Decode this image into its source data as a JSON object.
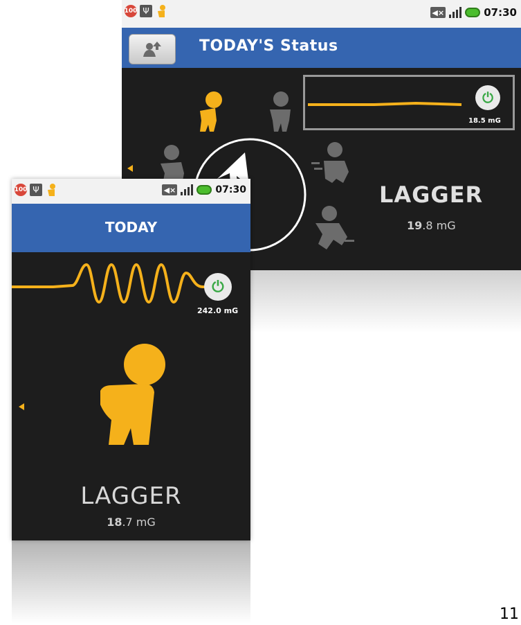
{
  "back_screen": {
    "statusbar": {
      "notif_badge": "100",
      "time": "07:30",
      "icons": [
        "battery-saver-icon",
        "usb-icon",
        "activity-figure-icon",
        "mute-icon",
        "signal-icon",
        "battery-icon"
      ]
    },
    "title": "TODAY'S Status",
    "share_button_icon": "share-person-icon",
    "reading_mg": "18.5 mG",
    "status_name": "LAGGER",
    "status_value_int": "19",
    "status_value_dec": ".8 mG",
    "colors": {
      "accent": "#f5b11b",
      "titlebar": "#3565b0",
      "figure_gray": "#6c6c6c",
      "power_green": "#39a845"
    }
  },
  "front_screen": {
    "statusbar": {
      "notif_badge": "100",
      "time": "07:30"
    },
    "title": "TODAY",
    "reading_mg": "242.0 mG",
    "status_name": "LAGGER",
    "status_value_int": "18",
    "status_value_dec": ".7 mG"
  },
  "page_number": "11"
}
